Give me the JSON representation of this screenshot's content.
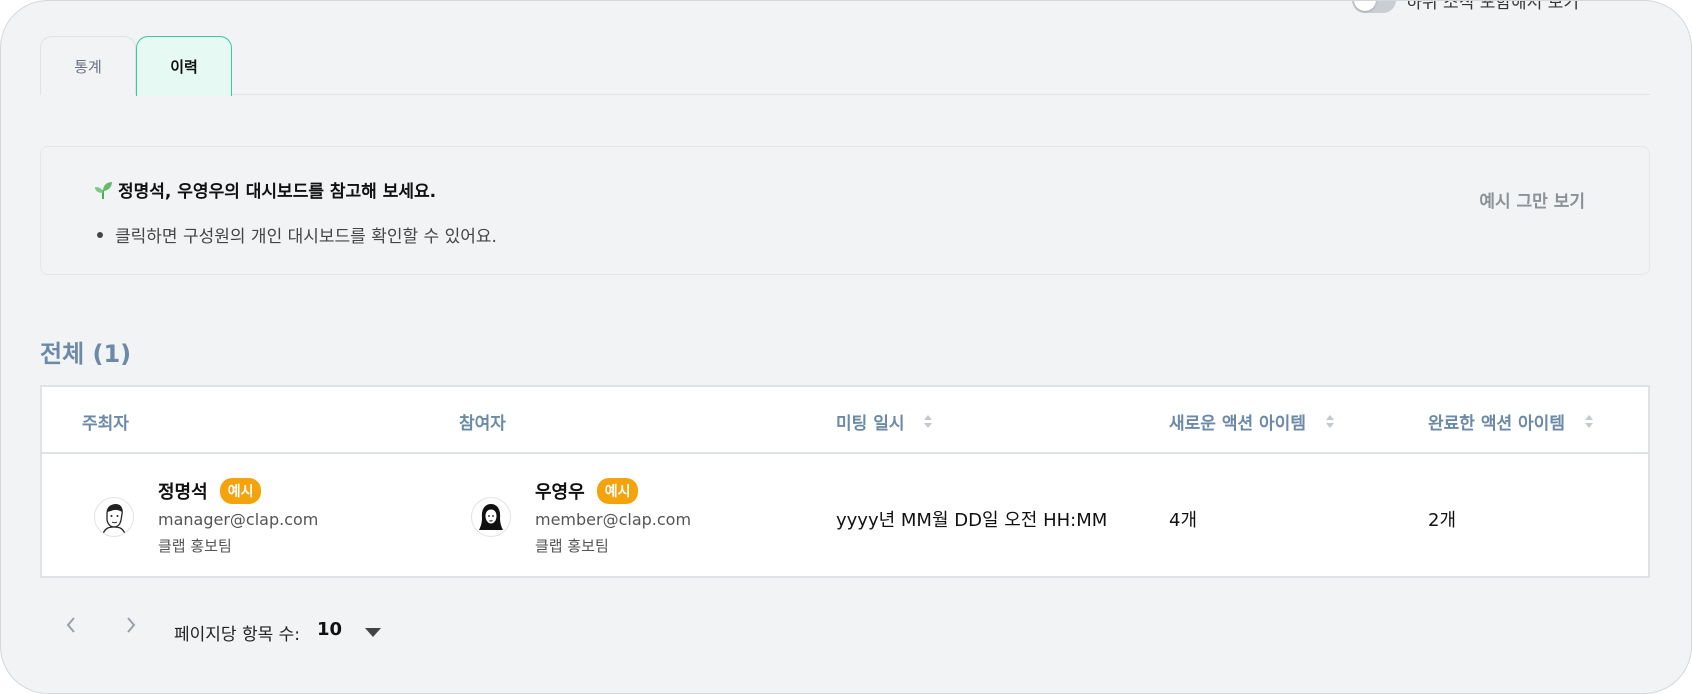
{
  "toggle": {
    "label": "하위 조직 포함해서 보기",
    "checked": false
  },
  "tabs": [
    {
      "label": "통계",
      "active": false
    },
    {
      "label": "이력",
      "active": true
    }
  ],
  "notice": {
    "icon": "sprout-icon",
    "title": "정명석, 우영우의 대시보드를 참고해 보세요.",
    "bullet": "클릭하면 구성원의 개인 대시보드를 확인할 수 있어요.",
    "dismiss_label": "예시 그만 보기"
  },
  "section": {
    "title": "전체 (1)"
  },
  "table": {
    "headers": {
      "host": "주최자",
      "participant": "참여자",
      "meeting_time": "미팅 일시",
      "new_actions": "새로운 액션 아이템",
      "done_actions": "완료한 액션 아이템"
    },
    "rows": [
      {
        "host": {
          "name": "정명석",
          "badge": "예시",
          "email": "manager@clap.com",
          "team": "클랩 홍보팀"
        },
        "participant": {
          "name": "우영우",
          "badge": "예시",
          "email": "member@clap.com",
          "team": "클랩 홍보팀"
        },
        "meeting_time": "yyyy년 MM월 DD일 오전 HH:MM",
        "new_actions": "4개",
        "done_actions": "2개"
      }
    ]
  },
  "pagination": {
    "per_page_label": "페이지당 항목 수:",
    "per_page_value": "10"
  },
  "colors": {
    "accent": "#3fc79a",
    "badge": "#f5a30d",
    "header_text": "#6b8aa8",
    "background": "#f1f3f5"
  }
}
